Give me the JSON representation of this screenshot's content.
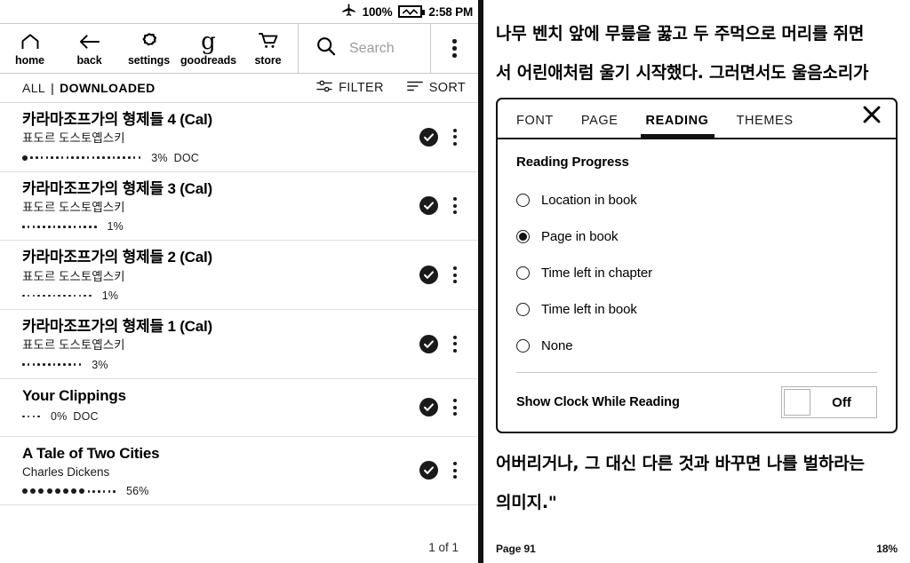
{
  "left_screen": {
    "status_bar": {
      "airplane_icon": "airplane-mode-icon",
      "battery_percent": "100%",
      "battery_icon": "battery-charging-icon",
      "time": "2:58 PM"
    },
    "toolbar": {
      "items": [
        {
          "icon": "home-icon",
          "label": "home"
        },
        {
          "icon": "back-arrow-icon",
          "label": "back"
        },
        {
          "icon": "gear-icon",
          "label": "settings"
        },
        {
          "icon": "goodreads-icon",
          "label": "goodreads"
        },
        {
          "icon": "shopping-cart-icon",
          "label": "store"
        }
      ],
      "search": {
        "icon": "search-icon",
        "value": "",
        "placeholder": "Search"
      },
      "overflow_icon": "kebab-menu-icon"
    },
    "filter_bar": {
      "all_label": "ALL",
      "separator": "|",
      "downloaded_label": "DOWNLOADED",
      "filter_label": "FILTER",
      "filter_icon": "sliders-icon",
      "sort_label": "SORT",
      "sort_icon": "sort-lines-icon"
    },
    "books": [
      {
        "title": "카라마조프가의 형제들 4 (Cal)",
        "author": "표도르 도스토옙스키",
        "percent": "3%",
        "format": "DOC",
        "dots_total": 23,
        "dots_filled": 1,
        "downloaded_icon": "check-circle-icon",
        "overflow_icon": "kebab-menu-icon"
      },
      {
        "title": "카라마조프가의 형제들 3 (Cal)",
        "author": "표도르 도스토옙스키",
        "percent": "1%",
        "format": "",
        "dots_total": 15,
        "dots_filled": 0,
        "downloaded_icon": "check-circle-icon",
        "overflow_icon": "kebab-menu-icon"
      },
      {
        "title": "카라마조프가의 형제들 2 (Cal)",
        "author": "표도르 도스토옙스키",
        "percent": "1%",
        "format": "",
        "dots_total": 14,
        "dots_filled": 0,
        "downloaded_icon": "check-circle-icon",
        "overflow_icon": "kebab-menu-icon"
      },
      {
        "title": "카라마조프가의 형제들 1 (Cal)",
        "author": "표도르 도스토옙스키",
        "percent": "3%",
        "format": "",
        "dots_total": 12,
        "dots_filled": 0,
        "downloaded_icon": "check-circle-icon",
        "overflow_icon": "kebab-menu-icon"
      },
      {
        "title": "Your Clippings",
        "author": "",
        "percent": "0%",
        "format": "DOC",
        "dots_total": 4,
        "dots_filled": 0,
        "downloaded_icon": "check-circle-icon",
        "overflow_icon": "kebab-menu-icon"
      },
      {
        "title": "A Tale of Two Cities",
        "author": "Charles Dickens",
        "percent": "56%",
        "format": "",
        "dots_total": 14,
        "dots_filled": 8,
        "downloaded_icon": "check-circle-icon",
        "overflow_icon": "kebab-menu-icon"
      }
    ],
    "pagination": "1 of 1"
  },
  "right_screen": {
    "text_above": [
      "나무 벤치 앞에 무릎을 꿇고 두 주먹으로 머리를 쥐면",
      "서 어린애처럼 울기 시작했다. 그러면서도 울음소리가"
    ],
    "panel": {
      "tabs": [
        {
          "label": "FONT",
          "active": false
        },
        {
          "label": "PAGE",
          "active": false
        },
        {
          "label": "READING",
          "active": true
        },
        {
          "label": "THEMES",
          "active": false
        }
      ],
      "close_icon": "close-icon",
      "heading": "Reading Progress",
      "options": [
        {
          "label": "Location in book",
          "selected": false
        },
        {
          "label": "Page in book",
          "selected": true
        },
        {
          "label": "Time left in chapter",
          "selected": false
        },
        {
          "label": "Time left in book",
          "selected": false
        },
        {
          "label": "None",
          "selected": false
        }
      ],
      "clock_setting": {
        "label": "Show Clock While Reading",
        "state": "Off"
      }
    },
    "text_below": [
      "어버리거나, 그 대신 다른 것과 바꾸면 나를 벌하라는",
      "의미지.\""
    ],
    "footer": {
      "page": "Page 91",
      "progress": "18%"
    }
  },
  "colors": {
    "ink": "#111111",
    "paper": "#ffffff",
    "muted": "#9b9b9b",
    "rule": "#dedede"
  }
}
